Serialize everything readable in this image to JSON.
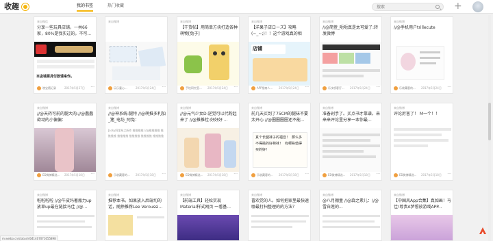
{
  "app": {
    "title": "收趣"
  },
  "tabs": [
    {
      "label": "我的书签",
      "active": true
    },
    {
      "label": "热门收藏",
      "active": false
    }
  ],
  "search": {
    "placeholder": "搜索"
  },
  "colors": {
    "accent": "#f5b50b",
    "background": "#f1f1f1"
  },
  "cards": [
    {
      "source": "来自微信",
      "title": "分享一些玩具店铺，一共66家，80%是我实过的，不可...",
      "body": "",
      "caption": "本店钱票月付款请来作。",
      "author": "晓宝随记录",
      "date": "2017年5月27日"
    },
    {
      "source": "来自微博",
      "title": "",
      "body": "",
      "caption": "",
      "author": "玩乐童心...",
      "date": "2017年5月24日"
    },
    {
      "source": "来自微博",
      "title": "【干货帖】用简单方块打造各种萌物[兔子]",
      "body": "",
      "caption": "",
      "author": "手绘研究室...",
      "date": "2017年5月24日"
    },
    {
      "source": "来自微博",
      "title": "【洋果子店ローズ】攻略(~_~;)！！这个游戏真的相当...",
      "body": "",
      "caption": "店铺",
      "author": "APP指南人...",
      "date": "2017年5月24日"
    },
    {
      "source": "来自微博",
      "title": "//@简萱_呃呃真是太可爱了:转发微博",
      "body": "",
      "caption": "",
      "author": "乐技喷客厅...",
      "date": "2017年5月24日"
    },
    {
      "source": "来自微博",
      "title": "//@手机用户trillecute",
      "body": "",
      "caption": "",
      "author": "乐收藏客的...",
      "date": "2017年5月24日"
    },
    {
      "source": "来自微博",
      "title": "//@天药可前的腿大肉://@蠢蠢欲动的小偏偏：",
      "body": "",
      "caption": "",
      "author": "ED微博精选...",
      "date": "2017年5月18日"
    },
    {
      "source": "来自微博",
      "title": "//@神系统:腿特 //@萌推多利加_猪_电坊_阿兔：",
      "body": "Jacky阿里系之所作 推推推推 //@推推推推 推推推推 推推推推 推推推推 推推推推 推推推推",
      "caption": "",
      "author": "乐收藏客的...",
      "date": "2017年5月18日"
    },
    {
      "source": "来自微博",
      "title": "//@元气少女D:逆觉可以代购起来了 //@推推栓:好好好 ...",
      "body": "",
      "caption": "",
      "author": "ED微博精选...",
      "date": "2017年5月18日"
    },
    {
      "source": "来自微博",
      "title": "前几天买到了75CM的腿袜不要太开心 //@圈圈圈圈还不能...",
      "body": "",
      "caption": "真个长腿袜子的福音！ 那么多不得挑的好棉袜！ 有哪些值得买的好！",
      "author": "乐收藏客的...",
      "date": "2017年5月18日"
    },
    {
      "source": "来自微博",
      "title": "准备剁手了。买点书才靠谱。来来来评论里分享一本你最...",
      "body": "",
      "caption": "",
      "author": "ED微博精选...",
      "date": "2017年5月18日"
    },
    {
      "source": "来自微博",
      "title": "评论厉害了！ M一个！！",
      "body": "",
      "caption": "",
      "author": "ED微博精选...",
      "date": "2017年5月18日"
    },
    {
      "source": "来自微博",
      "title": "啦啦啦啦 //@牛皮玛著瓶力up放草up最在链接马佳 //@...",
      "body": "",
      "caption": "",
      "author": "",
      "date": ""
    },
    {
      "source": "来自微博",
      "title": "推荐本书。如果放入后端切的话，随挣推荐Lee Veroussi...",
      "body": "",
      "caption": "",
      "author": "",
      "date": ""
    },
    {
      "source": "来自微博",
      "title": "【前端工具】轻松实现Material样式网页 一看基...",
      "body": "",
      "caption": "",
      "author": "",
      "date": ""
    },
    {
      "source": "来自微博",
      "title": "喜欢党的人。如何把家里最快速哪最打扫整理的的方法？",
      "body": "",
      "caption": "",
      "author": "",
      "date": ""
    },
    {
      "source": "来自微博",
      "title": "@八月棚量 //@森之素儿：//@雪白莲的...",
      "body": "",
      "caption": "",
      "author": "",
      "date": ""
    },
    {
      "source": "来自微博",
      "title": "【中国风App合集】真如画！马佳!尊贵A梦想放游戏APP...",
      "body": "",
      "caption": "",
      "author": "",
      "date": ""
    }
  ],
  "status_url": "m.weibo.cn/status/4041407071655898"
}
